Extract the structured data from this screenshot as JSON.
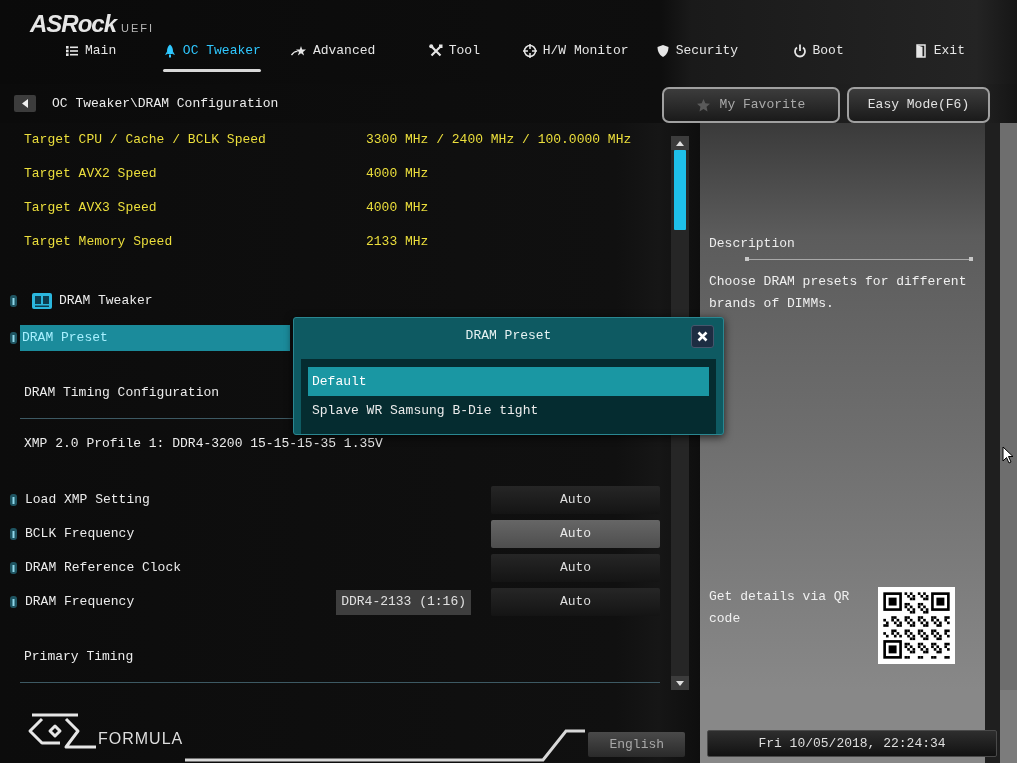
{
  "logo": {
    "brand": "ASRock",
    "product": "UEFI"
  },
  "tabs": [
    {
      "label": "Main",
      "selected": false
    },
    {
      "label": "OC Tweaker",
      "selected": true
    },
    {
      "label": "Advanced",
      "selected": false
    },
    {
      "label": "Tool",
      "selected": false
    },
    {
      "label": "H/W Monitor",
      "selected": false
    },
    {
      "label": "Security",
      "selected": false
    },
    {
      "label": "Boot",
      "selected": false
    },
    {
      "label": "Exit",
      "selected": false
    }
  ],
  "breadcrumb": "OC Tweaker\\DRAM Configuration",
  "header_buttons": [
    {
      "label": "My Favorite"
    },
    {
      "label": "Easy Mode(F6)"
    }
  ],
  "info_rows": [
    {
      "label": "Target CPU / Cache / BCLK Speed",
      "value": "3300 MHz / 2400 MHz / 100.0000 MHz"
    },
    {
      "label": "Target AVX2 Speed",
      "value": "4000 MHz"
    },
    {
      "label": "Target AVX3 Speed",
      "value": "4000 MHz"
    },
    {
      "label": "Target Memory Speed",
      "value": "2133 MHz"
    }
  ],
  "settings": [
    {
      "kind": "submenu",
      "label": "DRAM Tweaker",
      "selected": false
    },
    {
      "kind": "option",
      "label": "DRAM Preset",
      "selected": true
    },
    {
      "kind": "section",
      "label": "DRAM Timing Configuration"
    },
    {
      "kind": "note",
      "label": "XMP 2.0 Profile 1: DDR4-3200 15-15-15-35 1.35V"
    },
    {
      "kind": "option",
      "label": "Load XMP Setting",
      "selected": false,
      "value": "Auto",
      "hovered": false
    },
    {
      "kind": "option",
      "label": "BCLK Frequency",
      "selected": false,
      "value": "Auto",
      "hovered": true
    },
    {
      "kind": "option",
      "label": "DRAM Reference Clock",
      "selected": false,
      "value": "Auto",
      "hovered": false
    },
    {
      "kind": "option",
      "label": "DRAM Frequency",
      "selected": false,
      "tag": "DDR4-2133 (1:16)",
      "value": "Auto",
      "hovered": false
    },
    {
      "kind": "section",
      "label": "Primary Timing"
    }
  ],
  "popup": {
    "title": "DRAM Preset",
    "options": [
      {
        "label": "Default",
        "selected": true
      },
      {
        "label": "Splave WR Samsung B-Die tight",
        "selected": false
      }
    ]
  },
  "description": {
    "heading": "Description",
    "text": "Choose DRAM presets for different brands of DIMMs.",
    "qr_caption": "Get details via QR code"
  },
  "footer": {
    "brand": "FORMULA",
    "language": "English",
    "datetime": "Fri 10/05/2018, 22:24:34"
  }
}
